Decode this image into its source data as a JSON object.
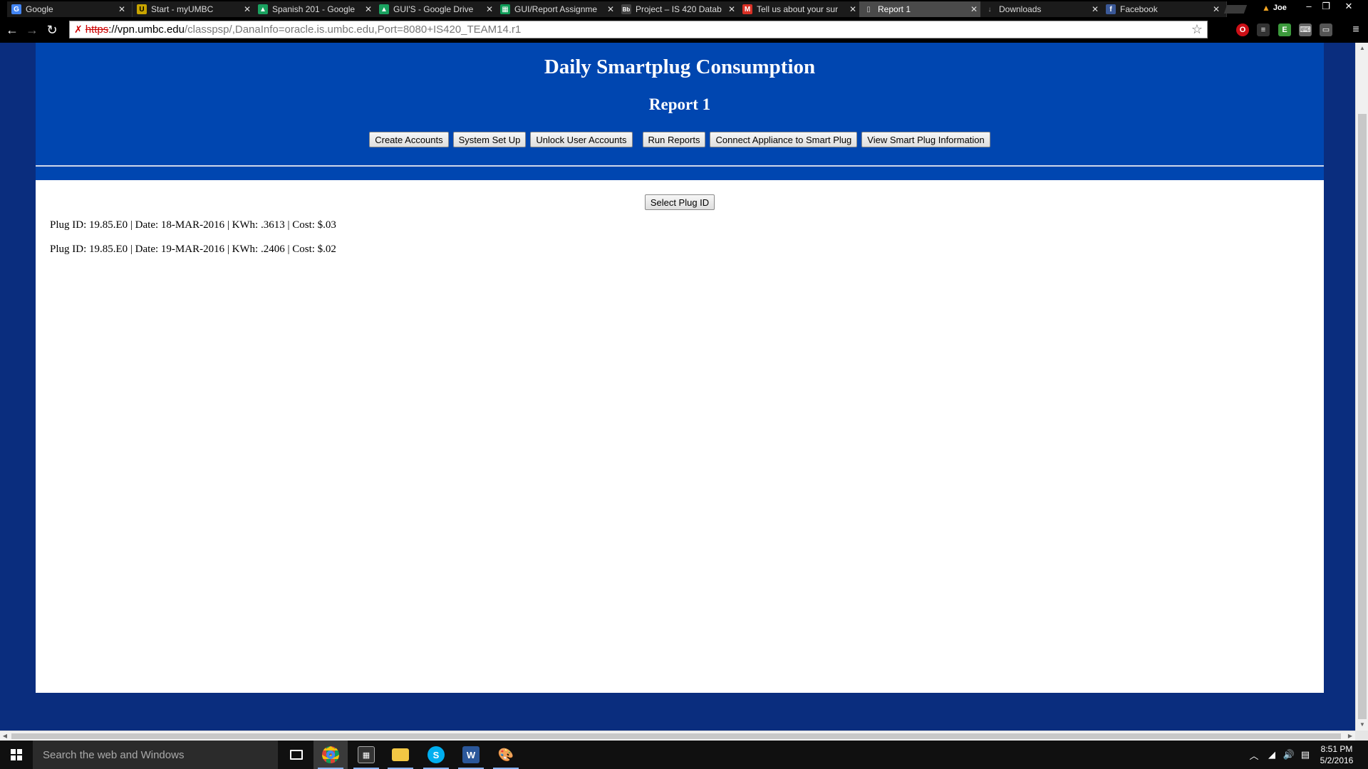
{
  "tabs": [
    {
      "title": "Google",
      "icon": "G",
      "color": "#4285f4"
    },
    {
      "title": "Start - myUMBC",
      "icon": "U",
      "color": "#c8a400"
    },
    {
      "title": "Spanish 201 - Google",
      "icon": "▲",
      "color": "#1aa260"
    },
    {
      "title": "GUI'S - Google Drive",
      "icon": "▲",
      "color": "#1aa260"
    },
    {
      "title": "GUI/Report Assignme",
      "icon": "▦",
      "color": "#0f9d58"
    },
    {
      "title": "Project – IS 420 Datab",
      "icon": "Bb",
      "color": "#444"
    },
    {
      "title": "Tell us about your sur",
      "icon": "M",
      "color": "#d93025"
    },
    {
      "title": "Report 1",
      "icon": "▯",
      "color": "#666"
    },
    {
      "title": "Downloads",
      "icon": "↓",
      "color": "#555"
    },
    {
      "title": "Facebook",
      "icon": "f",
      "color": "#3b5998"
    }
  ],
  "profile": {
    "name": "Joe"
  },
  "address": {
    "scheme": "https",
    "host": "://vpn.umbc.edu",
    "path": "/classpsp/,DanaInfo=oracle.is.umbc.edu,Port=8080+IS420_TEAM14.r1"
  },
  "page": {
    "title": "Daily Smartplug Consumption",
    "subtitle": "Report 1",
    "nav_buttons": [
      "Create Accounts",
      "System Set Up",
      "Unlock User Accounts",
      "Run Reports",
      "Connect Appliance to Smart Plug",
      "View Smart Plug Information"
    ],
    "select_button": "Select Plug ID",
    "records": [
      "Plug ID: 19.85.E0 | Date: 18-MAR-2016 | KWh: .3613 | Cost: $.03",
      "Plug ID: 19.85.E0 | Date: 19-MAR-2016 | KWh: .2406 | Cost: $.02"
    ]
  },
  "taskbar": {
    "search_placeholder": "Search the web and Windows",
    "apps": [
      "task-view",
      "chrome",
      "calculator",
      "file-explorer",
      "skype",
      "word",
      "paint"
    ],
    "time": "8:51 PM",
    "date": "5/2/2016"
  },
  "colors": {
    "page_bg": "#0a2d7e",
    "header_bg": "#0046b0",
    "content_bg": "#ffffff"
  }
}
